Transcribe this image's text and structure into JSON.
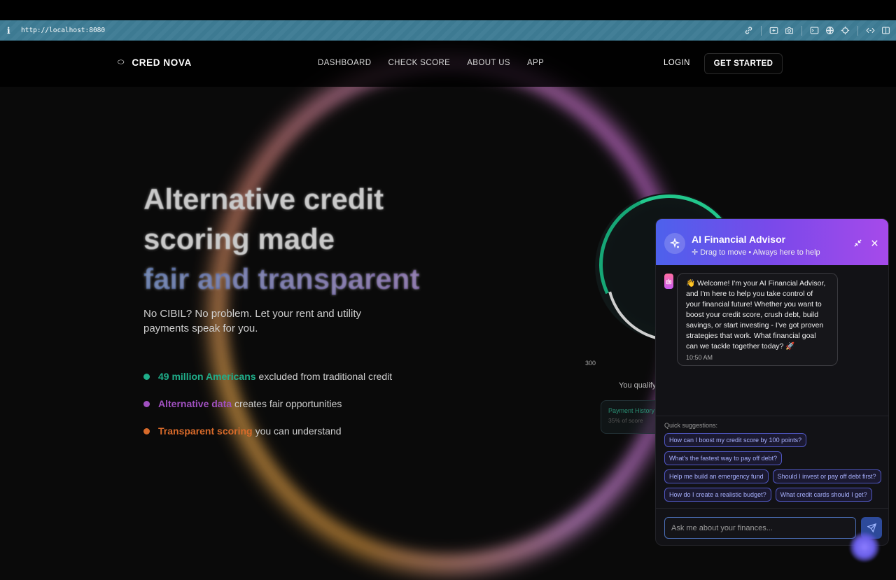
{
  "browser": {
    "url": "http://localhost:8080"
  },
  "nav": {
    "brand": "CRED NOVA",
    "links": [
      "DASHBOARD",
      "CHECK SCORE",
      "ABOUT US",
      "APP"
    ],
    "login": "LOGIN",
    "cta": "GET STARTED"
  },
  "hero": {
    "title_line1": "Alternative credit",
    "title_line2": "scoring made",
    "title_line3": "fair and transparent",
    "subtitle": "No CIBIL? No problem. Let your rent and utility payments speak for you.",
    "features": [
      {
        "highlight": "49 million Americans",
        "rest": "excluded from traditional credit",
        "color": "#1fae8a"
      },
      {
        "highlight": "Alternative data",
        "rest": "creates fair opportunities",
        "color": "#a050c0"
      },
      {
        "highlight": "Transparent scoring",
        "rest": "you can understand",
        "color": "#d86a2a"
      }
    ]
  },
  "gauge": {
    "min_label": "300",
    "qualify_text": "You qualify for better rates",
    "card_title": "Payment History",
    "card_sub": "35% of score"
  },
  "chat": {
    "title": "AI Financial Advisor",
    "subtitle": "Drag to move • Always here to help",
    "message": "👋 Welcome! I'm your AI Financial Advisor, and I'm here to help you take control of your financial future! Whether you want to boost your credit score, crush debt, build savings, or start investing - I've got proven strategies that work. What financial goal can we tackle together today? 🚀",
    "time": "10:50 AM",
    "suggestions_label": "Quick suggestions:",
    "suggestions": [
      "How can I boost my credit score by 100 points?",
      "What's the fastest way to pay off debt?",
      "Help me build an emergency fund",
      "Should I invest or pay off debt first?",
      "How do I create a realistic budget?",
      "What credit cards should I get?"
    ],
    "input_placeholder": "Ask me about your finances..."
  }
}
